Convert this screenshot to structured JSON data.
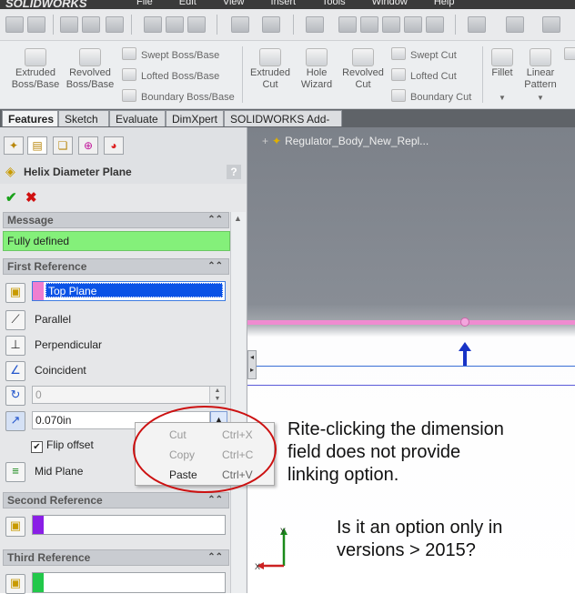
{
  "titlebar": {
    "logo": "SOLIDWORKS",
    "menus": [
      "File",
      "Edit",
      "View",
      "Insert",
      "Tools",
      "Window",
      "Help"
    ]
  },
  "command_manager": {
    "extruded_boss": "Extruded\nBoss/Base",
    "revolved_boss": "Revolved\nBoss/Base",
    "swept_boss": "Swept Boss/Base",
    "lofted_boss": "Lofted Boss/Base",
    "boundary_boss": "Boundary Boss/Base",
    "extruded_cut": "Extruded\nCut",
    "hole_wizard": "Hole\nWizard",
    "revolved_cut": "Revolved\nCut",
    "swept_cut": "Swept Cut",
    "lofted_cut": "Lofted Cut",
    "boundary_cut": "Boundary Cut",
    "fillet": "Fillet",
    "linear_pattern": "Linear\nPattern"
  },
  "tabs": [
    "Features",
    "Sketch",
    "Evaluate",
    "DimXpert",
    "SOLIDWORKS Add-Ins"
  ],
  "property_manager": {
    "title": "Helix Diameter Plane",
    "help": "?",
    "ok": "✔",
    "cancel": "✖",
    "message_header": "Message",
    "message": "Fully defined",
    "first_ref_header": "First Reference",
    "first_ref_value": "Top Plane",
    "constraints": [
      "Parallel",
      "Perpendicular",
      "Coincident"
    ],
    "angle_value": "0",
    "offset_value": "0.070in",
    "flip_offset": "Flip offset",
    "mid_plane": "Mid Plane",
    "second_ref_header": "Second Reference",
    "third_ref_header": "Third Reference",
    "colors": {
      "first": "#ef7ed0",
      "second": "#8a1fe6",
      "third": "#22c84a",
      "message_bg": "#84f07a"
    }
  },
  "viewport": {
    "tree_item": "Regulator_Body_New_Repl...",
    "axis_y": "Y",
    "axis_x": "X"
  },
  "context_menu": {
    "items": [
      {
        "label": "Cut",
        "shortcut": "Ctrl+X",
        "enabled": false
      },
      {
        "label": "Copy",
        "shortcut": "Ctrl+C",
        "enabled": false
      },
      {
        "label": "Paste",
        "shortcut": "Ctrl+V",
        "enabled": true
      }
    ]
  },
  "annotations": {
    "note1": [
      "Rite-clicking the dimension",
      "field does not provide",
      "linking option."
    ],
    "note2": [
      "Is it an option only in",
      "versions > 2015?"
    ]
  }
}
